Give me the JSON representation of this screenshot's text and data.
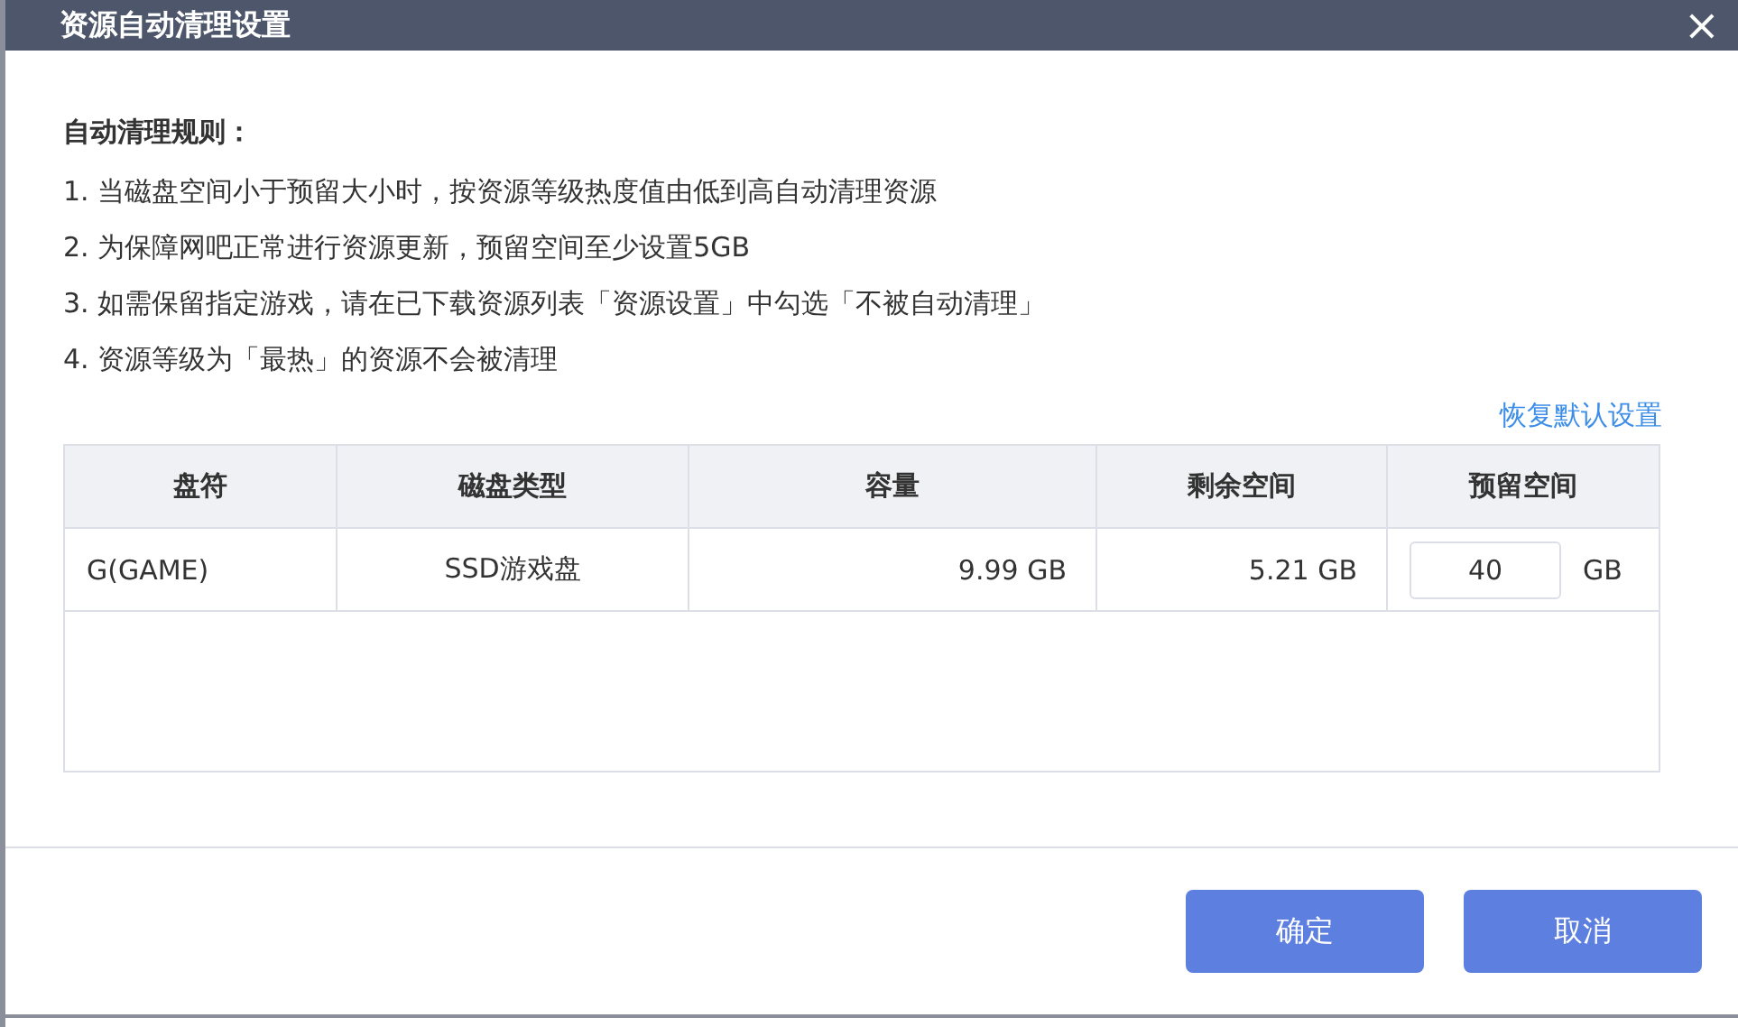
{
  "window": {
    "title": "资源自动清理设置",
    "close": "×"
  },
  "rules": {
    "heading": "自动清理规则：",
    "items": [
      "1. 当磁盘空间小于预留大小时，按资源等级热度值由低到高自动清理资源",
      "2. 为保障网吧正常进行资源更新，预留空间至少设置5GB",
      "3. 如需保留指定游戏，请在已下载资源列表「资源设置」中勾选「不被自动清理」",
      "4. 资源等级为「最热」的资源不会被清理"
    ]
  },
  "restore_link": "恢复默认设置",
  "table": {
    "columns": [
      "盘符",
      "磁盘类型",
      "容量",
      "剩余空间",
      "预留空间"
    ],
    "rows": [
      {
        "drive": "G(GAME)",
        "type": "SSD游戏盘",
        "capacity": "9.99 GB",
        "free": "5.21 GB",
        "reserve": "40",
        "unit": "GB"
      }
    ]
  },
  "buttons": [
    "确定",
    "取消"
  ]
}
